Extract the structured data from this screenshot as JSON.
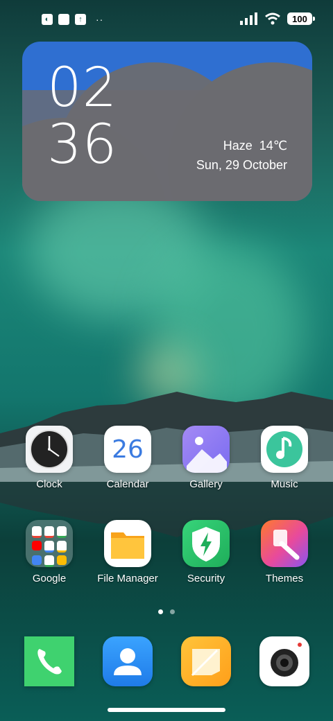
{
  "status_bar": {
    "battery": "100",
    "dots": "··"
  },
  "widget": {
    "hour": "02",
    "minute": "36",
    "condition": "Haze",
    "temperature": "14℃",
    "date": "Sun, 29 October"
  },
  "apps": [
    {
      "label": "Clock",
      "icon": "clock-icon"
    },
    {
      "label": "Calendar",
      "icon": "calendar-icon",
      "day": "26"
    },
    {
      "label": "Gallery",
      "icon": "gallery-icon"
    },
    {
      "label": "Music",
      "icon": "music-icon"
    },
    {
      "label": "Google",
      "icon": "google-folder-icon"
    },
    {
      "label": "File Manager",
      "icon": "folder-icon"
    },
    {
      "label": "Security",
      "icon": "shield-icon"
    },
    {
      "label": "Themes",
      "icon": "brush-icon"
    }
  ],
  "dock": [
    {
      "icon": "phone-icon"
    },
    {
      "icon": "contacts-icon"
    },
    {
      "icon": "notes-icon"
    },
    {
      "icon": "camera-icon"
    }
  ],
  "colors": {
    "widget_blue": "#2f6fd1",
    "calendar_blue": "#3b7be0"
  }
}
